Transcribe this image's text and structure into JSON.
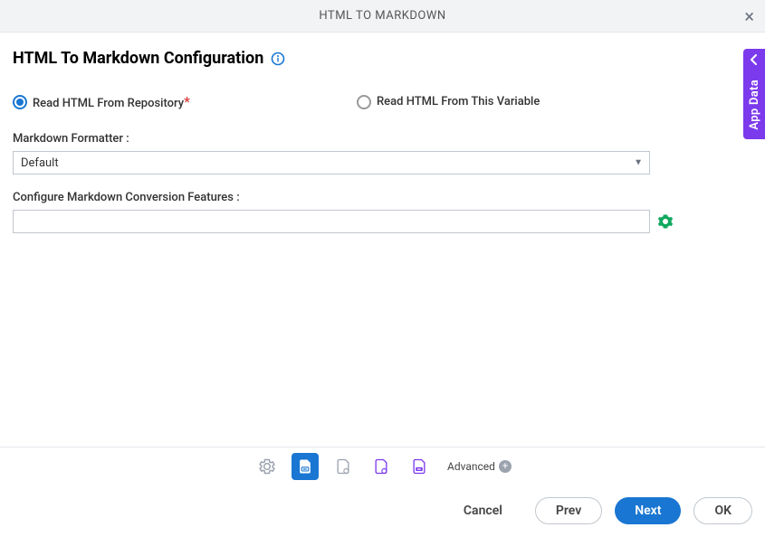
{
  "header": {
    "title": "HTML TO MARKDOWN"
  },
  "config": {
    "heading": "HTML To Markdown Configuration",
    "radio_repo": "Read HTML From Repository",
    "radio_repo_required": "*",
    "radio_var": "Read HTML From This Variable",
    "formatter_label": "Markdown Formatter :",
    "formatter_value": "Default",
    "features_label": "Configure Markdown Conversion Features :",
    "features_value": ""
  },
  "side_tab": {
    "label": "App Data"
  },
  "toolbar": {
    "advanced_label": "Advanced"
  },
  "footer": {
    "cancel_label": "Cancel",
    "prev_label": "Prev",
    "next_label": "Next",
    "ok_label": "OK"
  }
}
